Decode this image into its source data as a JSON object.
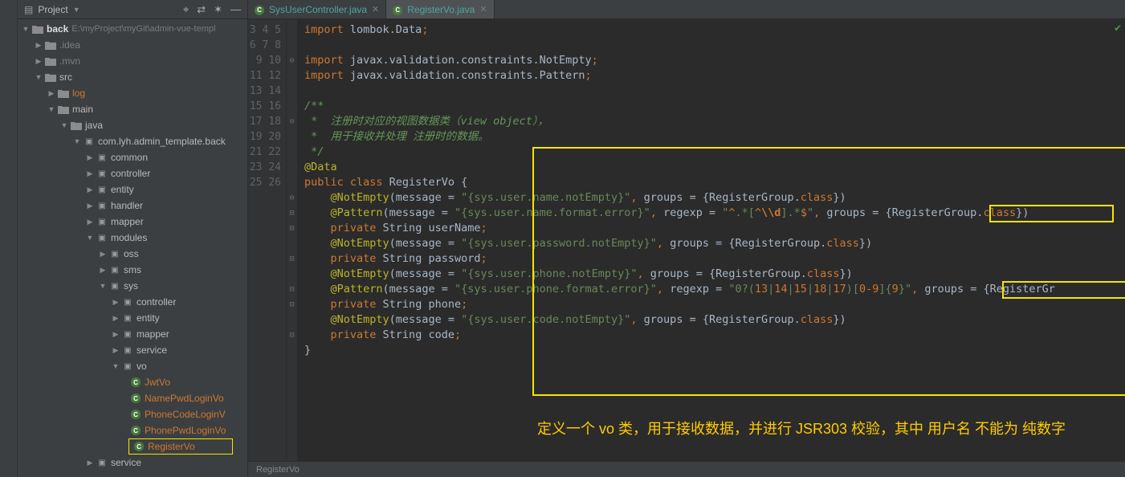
{
  "sidebar": {
    "title": "Project",
    "project_name": "back",
    "project_path": "E:\\myProject\\myGit\\admin-vue-templ",
    "tree": {
      "idea": ".idea",
      "mvn": ".mvn",
      "src": "src",
      "log": "log",
      "main": "main",
      "java": "java",
      "package": "com.lyh.admin_template.back",
      "common": "common",
      "controller": "controller",
      "entity": "entity",
      "handler": "handler",
      "mapper": "mapper",
      "modules": "modules",
      "oss": "oss",
      "sms": "sms",
      "sys": "sys",
      "sys_controller": "controller",
      "sys_entity": "entity",
      "sys_mapper": "mapper",
      "sys_service": "service",
      "vo": "vo",
      "jwtvo": "JwtVo",
      "namepwd": "NamePwdLoginVo",
      "phonecode": "PhoneCodeLoginV",
      "phonepwd": "PhonePwdLoginVo",
      "registervo": "RegisterVo",
      "service": "service"
    }
  },
  "tabs": [
    {
      "name": "SysUserController.java",
      "active": false
    },
    {
      "name": "RegisterVo.java",
      "active": true
    }
  ],
  "line_start": 3,
  "line_end": 26,
  "code": {
    "l3": "import lombok.Data;",
    "l5": "import javax.validation.constraints.NotEmpty;",
    "l6": "import javax.validation.constraints.Pattern;",
    "c1": "/**",
    "c2": " *  注册时对应的视图数据类（view object），",
    "c3": " *  用于接收并处理 注册时的数据。",
    "c4": " */",
    "a_data": "@Data",
    "classdecl": "public class RegisterVo {",
    "ne_name_msg": "\"{sys.user.name.notEmpty}\"",
    "p_name_msg": "\"{sys.user.name.format.error}\"",
    "p_name_re": "\"^.*[^\\\\d].*$\"",
    "f_username": "private String userName;",
    "ne_pwd_msg": "\"{sys.user.password.notEmpty}\"",
    "f_password": "private String password;",
    "ne_phone_msg": "\"{sys.user.phone.notEmpty}\"",
    "p_phone_msg": "\"{sys.user.phone.format.error}\"",
    "p_phone_re": "\"0?(13|14|15|18|17)[0-9]{9}\"",
    "f_phone": "private String phone;",
    "ne_code_msg": "\"{sys.user.code.notEmpty}\"",
    "f_code": "private String code;",
    "groups": "groups = {RegisterGroup.class}",
    "close": "}"
  },
  "annotation": "定义一个 vo 类，用于接收数据，并进行 JSR303 校验，其中 用户名 不能为 纯数字",
  "breadcrumb": "RegisterVo",
  "chart_data": null
}
